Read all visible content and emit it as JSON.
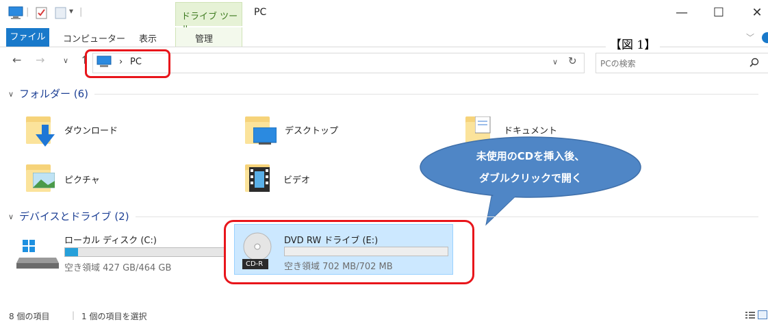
{
  "window": {
    "title": "PC",
    "contextual_tab": "ドライブ ツール",
    "controls": [
      "—",
      "☐",
      "✕"
    ]
  },
  "ribbon": {
    "file_tab": "ファイル",
    "tabs": [
      "コンピューター",
      "表示",
      "管理"
    ]
  },
  "annotation": {
    "figure_label": "【図 1】",
    "callout_lines": [
      "未使用のCDを挿入後、",
      "ダブルクリックで開く"
    ]
  },
  "address_bar": {
    "path_separator": "›",
    "path": "PC",
    "search_placeholder": "PCの検索"
  },
  "folders_group": {
    "header": "フォルダー (6)",
    "items": [
      {
        "label": "ダウンロード",
        "icon": "downloads-folder-icon"
      },
      {
        "label": "デスクトップ",
        "icon": "desktop-folder-icon"
      },
      {
        "label": "ドキュメント",
        "icon": "documents-folder-icon"
      },
      {
        "label": "ピクチャ",
        "icon": "pictures-folder-icon"
      },
      {
        "label": "ビデオ",
        "icon": "videos-folder-icon"
      }
    ]
  },
  "devices_group": {
    "header": "デバイスとドライブ (2)",
    "drives": [
      {
        "name": "ローカル ディスク (C:)",
        "free_text": "空き領域 427 GB/464 GB",
        "used_fraction": 0.08,
        "icon": "hard-drive-icon"
      },
      {
        "name": "DVD RW ドライブ (E:)",
        "free_text": "空き領域 702 MB/702 MB",
        "used_fraction": 0.0,
        "icon": "cd-r-disc-icon",
        "badge": "CD-R"
      }
    ]
  },
  "status_bar": {
    "item_count": "8 個の項目",
    "selection": "1 個の項目を選択"
  },
  "colors": {
    "accent": "#1979ca",
    "highlight_ring": "#e8151b",
    "callout_fill": "#4f86c6",
    "selection": "#cce8ff"
  }
}
